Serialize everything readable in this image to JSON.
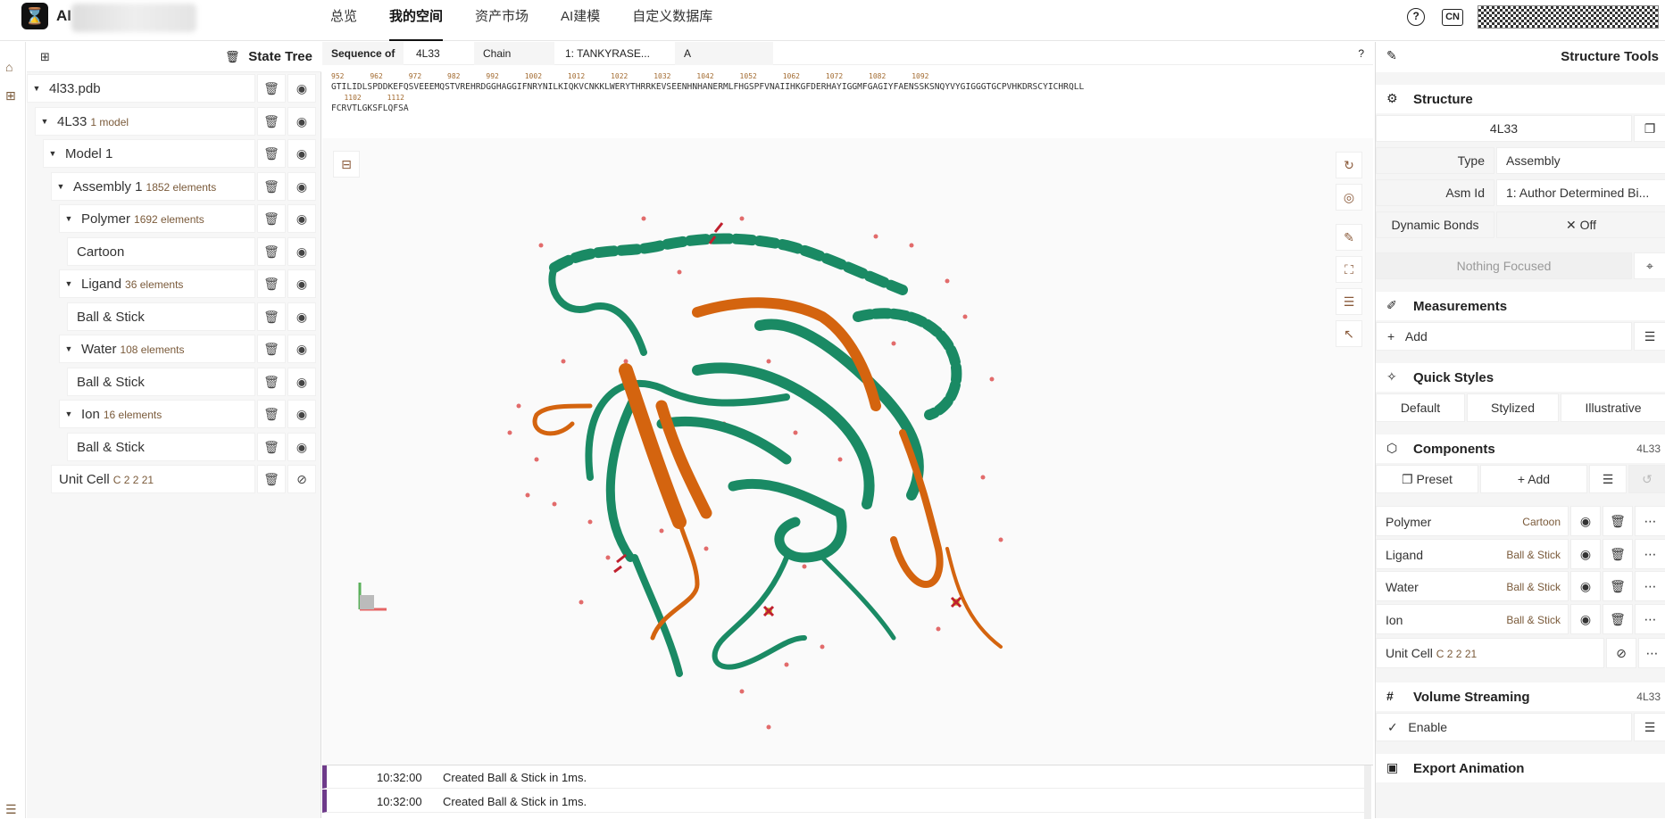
{
  "header": {
    "brand": "AI",
    "nav": [
      "总览",
      "我的空间",
      "资产市场",
      "AI建模",
      "自定义数据库"
    ],
    "active_nav": 1,
    "cn": "CN",
    "help": "?"
  },
  "tree": {
    "title": "State Tree",
    "rows": [
      {
        "label": "4l33.pdb",
        "meta": "",
        "indent": 0,
        "caret": true,
        "eye": "◉"
      },
      {
        "label": "4L33",
        "meta": "1 model",
        "indent": 1,
        "caret": true,
        "eye": "◉"
      },
      {
        "label": "Model 1",
        "meta": "",
        "indent": 2,
        "caret": true,
        "eye": "◉"
      },
      {
        "label": "Assembly 1",
        "meta": "1852 elements",
        "indent": 3,
        "caret": true,
        "eye": "◉"
      },
      {
        "label": "Polymer",
        "meta": "1692 elements",
        "indent": 4,
        "caret": true,
        "eye": "◉"
      },
      {
        "label": "Cartoon",
        "meta": "",
        "indent": 5,
        "caret": false,
        "eye": "◉"
      },
      {
        "label": "Ligand",
        "meta": "36 elements",
        "indent": 4,
        "caret": true,
        "eye": "◉"
      },
      {
        "label": "Ball & Stick",
        "meta": "",
        "indent": 5,
        "caret": false,
        "eye": "◉"
      },
      {
        "label": "Water",
        "meta": "108 elements",
        "indent": 4,
        "caret": true,
        "eye": "◉"
      },
      {
        "label": "Ball & Stick",
        "meta": "",
        "indent": 5,
        "caret": false,
        "eye": "◉"
      },
      {
        "label": "Ion",
        "meta": "16 elements",
        "indent": 4,
        "caret": true,
        "eye": "◉"
      },
      {
        "label": "Ball & Stick",
        "meta": "",
        "indent": 5,
        "caret": false,
        "eye": "◉"
      },
      {
        "label": "Unit Cell",
        "meta": "C 2 2 21",
        "indent": 3,
        "caret": false,
        "eye": "⊘"
      }
    ]
  },
  "sequence": {
    "label": "Sequence of",
    "entry": "4L33",
    "chain_label": "Chain",
    "entity": "1: TANKYRASE...",
    "chain": "A",
    "nums1": "952      962      972      982      992      1002      1012      1022      1032      1042      1052      1062      1072      1082      1092",
    "line1": "GTILIDLSPDDKEFQSVEEEMQSTVREHRDGGHAGGIFNRYNILKIQKVCNKKLWERYTHRRKEVSEENHNHANERMLFHGSPFVNAIIHKGFDERHAYIGGMFGAGIYFAENSSKSNQYVYGIGGGTGCPVHKDRSCYICHRQLL",
    "nums2": "   1102      1112",
    "line2": "FCRVTLGKSFLQFSA"
  },
  "log": [
    {
      "time": "10:32:00",
      "msg": "Created Ball & Stick in 1ms."
    },
    {
      "time": "10:32:00",
      "msg": "Created Ball & Stick in 1ms."
    }
  ],
  "tools": {
    "title": "Structure Tools",
    "structure": {
      "title": "Structure",
      "entry": "4L33",
      "type_label": "Type",
      "type_value": "Assembly",
      "asm_label": "Asm Id",
      "asm_value": "1: Author Determined Bi...",
      "bonds_label": "Dynamic Bonds",
      "bonds_value": "✕  Off",
      "focus": "Nothing Focused"
    },
    "measurements": {
      "title": "Measurements",
      "add": "Add"
    },
    "quick_styles": {
      "title": "Quick Styles",
      "options": [
        "Default",
        "Stylized",
        "Illustrative"
      ]
    },
    "components": {
      "title": "Components",
      "entry": "4L33",
      "preset": "Preset",
      "add": "Add",
      "items": [
        {
          "name": "Polymer",
          "rep": "Cartoon"
        },
        {
          "name": "Ligand",
          "rep": "Ball & Stick"
        },
        {
          "name": "Water",
          "rep": "Ball & Stick"
        },
        {
          "name": "Ion",
          "rep": "Ball & Stick"
        }
      ],
      "unit_cell": {
        "name": "Unit Cell",
        "meta": "C 2 2 21"
      }
    },
    "volume": {
      "title": "Volume Streaming",
      "entry": "4L33",
      "enable": "Enable"
    },
    "export": {
      "title": "Export Animation"
    }
  },
  "colors": {
    "helix": "#1a8a64",
    "sheet": "#d4640f",
    "water": "#e26b6b",
    "accent": "#6e3b8a"
  }
}
